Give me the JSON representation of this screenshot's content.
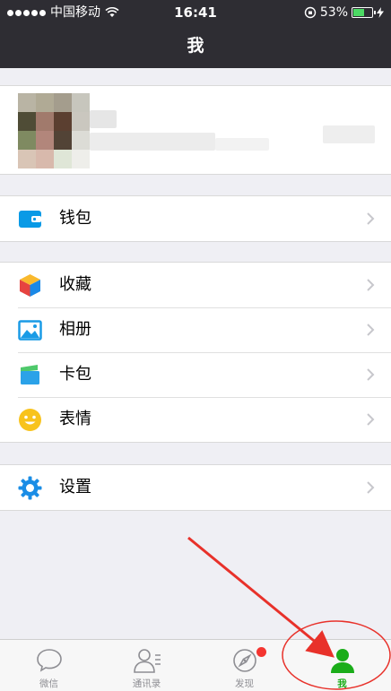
{
  "status_bar": {
    "carrier": "中国移动",
    "time": "16:41",
    "battery": "53%",
    "battery_level": 0.53
  },
  "nav": {
    "title": "我"
  },
  "menu": {
    "wallet": {
      "label": "钱包",
      "icon": "wallet-icon"
    },
    "favorites": {
      "label": "收藏",
      "icon": "favorites-cube-icon"
    },
    "album": {
      "label": "相册",
      "icon": "album-picture-icon"
    },
    "cards": {
      "label": "卡包",
      "icon": "card-wallet-icon"
    },
    "stickers": {
      "label": "表情",
      "icon": "smiley-icon"
    },
    "settings": {
      "label": "设置",
      "icon": "gear-icon"
    }
  },
  "tabs": [
    {
      "label": "微信",
      "icon": "chat-bubble-icon",
      "active": false
    },
    {
      "label": "通讯录",
      "icon": "contacts-icon",
      "active": false
    },
    {
      "label": "发现",
      "icon": "compass-icon",
      "active": false,
      "badge": true
    },
    {
      "label": "我",
      "icon": "person-icon",
      "active": true
    }
  ],
  "colors": {
    "nav_bg": "#2e2d33",
    "accent_green": "#1aad19",
    "annotation_red": "#e8312a",
    "badge_red": "#f43530"
  }
}
